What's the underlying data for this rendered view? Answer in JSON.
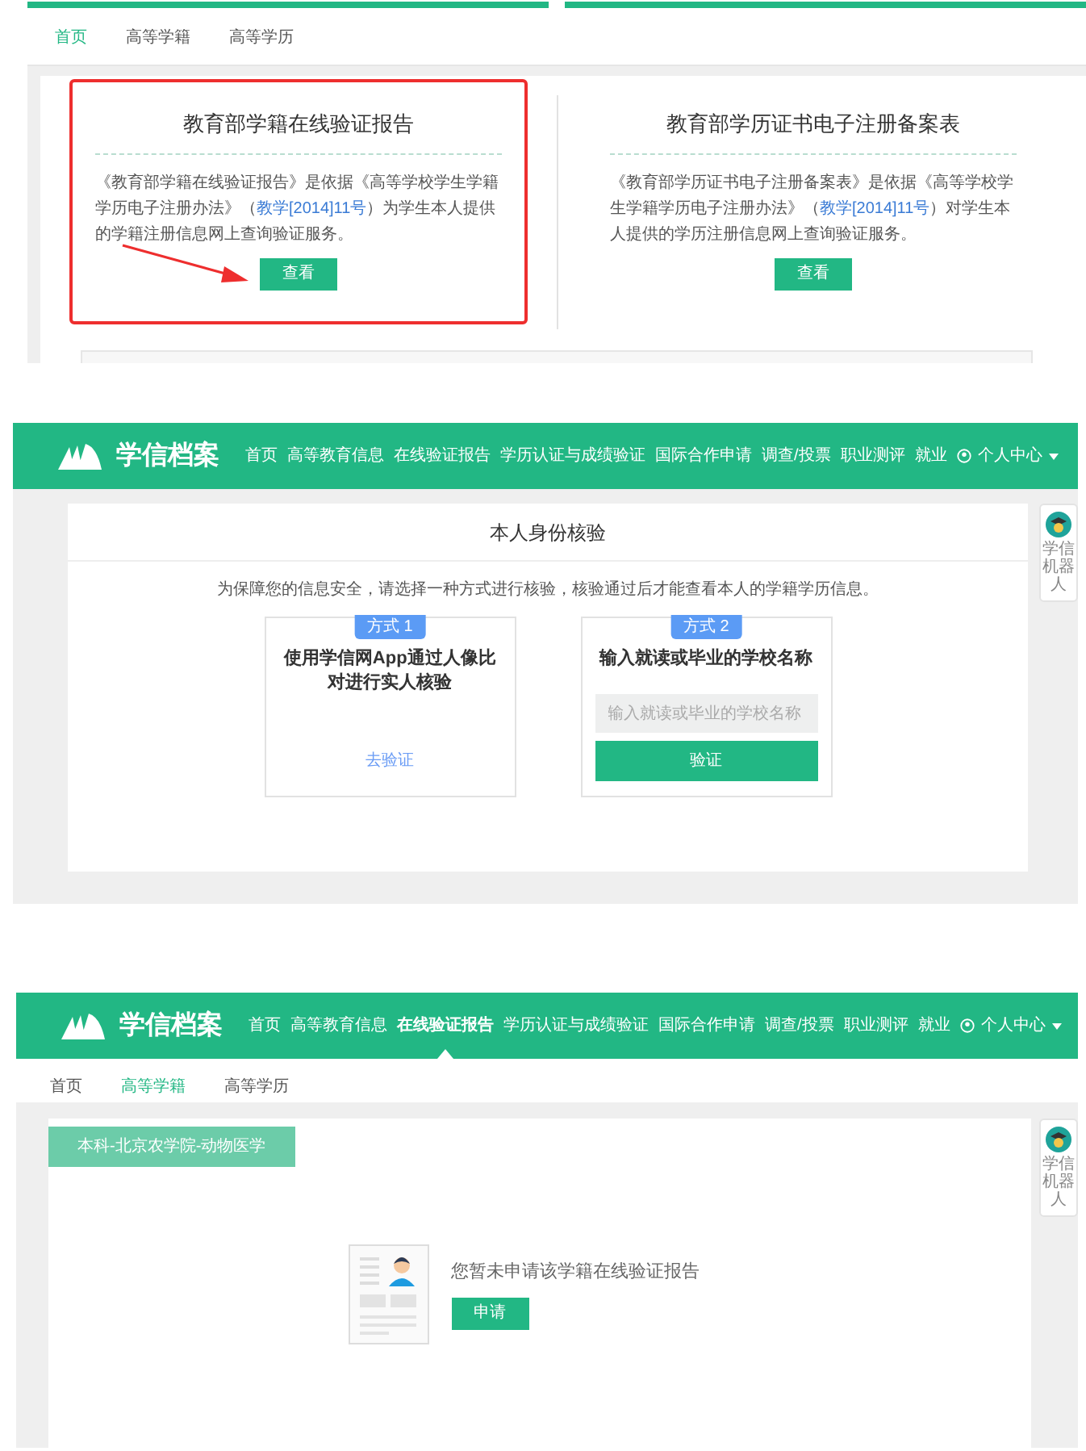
{
  "report_page": {
    "tabs": [
      {
        "label": "首页",
        "selected": true
      },
      {
        "label": "高等学籍",
        "selected": false
      },
      {
        "label": "高等学历",
        "selected": false
      }
    ],
    "cards": [
      {
        "title": "教育部学籍在线验证报告",
        "description": {
          "before": "《教育部学籍在线验证报告》是依据《高等学校学生学籍学历电子注册办法》（",
          "link": "教学[2014]11号",
          "after": "）为学生本人提供的学籍注册信息网上查询验证服务。"
        },
        "button": "查看",
        "highlighted": true,
        "pointer_arrow": true
      },
      {
        "title": "教育部学历证书电子注册备案表",
        "description": {
          "before": "《教育部学历证书电子注册备案表》是依据《高等学校学生学籍学历电子注册办法》（",
          "link": "教学[2014]11号",
          "after": "）对学生本人提供的学历注册信息网上查询验证服务。"
        },
        "button": "查看",
        "highlighted": false,
        "pointer_arrow": false
      }
    ]
  },
  "identity_page": {
    "navbar": {
      "logo": "学信档案",
      "items": [
        {
          "label": "首页",
          "selected": false
        },
        {
          "label": "高等教育信息",
          "selected": false
        },
        {
          "label": "在线验证报告",
          "selected": false
        },
        {
          "label": "学历认证与成绩验证",
          "selected": false
        },
        {
          "label": "国际合作申请",
          "selected": false
        },
        {
          "label": "调查/投票",
          "selected": false
        },
        {
          "label": "职业测评",
          "selected": false
        },
        {
          "label": "就业",
          "selected": false
        }
      ],
      "user_menu": "个人中心"
    },
    "title": "本人身份核验",
    "notice": "为保障您的信息安全，请选择一种方式进行核验，核验通过后才能查看本人的学籍学历信息。",
    "methods": [
      {
        "badge": "方式 1",
        "title": "使用学信网App通过人像比对进行实人核验",
        "kind": "link",
        "action": "去验证"
      },
      {
        "badge": "方式 2",
        "title": "输入就读或毕业的学校名称",
        "kind": "form",
        "placeholder": "输入就读或毕业的学校名称",
        "action": "验证"
      }
    ],
    "robot_widget": {
      "label": "学信机器人"
    }
  },
  "record_page": {
    "navbar": {
      "logo": "学信档案",
      "items": [
        {
          "label": "首页",
          "selected": false
        },
        {
          "label": "高等教育信息",
          "selected": false
        },
        {
          "label": "在线验证报告",
          "selected": true
        },
        {
          "label": "学历认证与成绩验证",
          "selected": false
        },
        {
          "label": "国际合作申请",
          "selected": false
        },
        {
          "label": "调查/投票",
          "selected": false
        },
        {
          "label": "职业测评",
          "selected": false
        },
        {
          "label": "就业",
          "selected": false
        }
      ],
      "user_menu": "个人中心"
    },
    "tabs": [
      {
        "label": "首页",
        "selected": false
      },
      {
        "label": "高等学籍",
        "selected": true
      },
      {
        "label": "高等学历",
        "selected": false
      }
    ],
    "record_tag": "本科-北京农学院-动物医学",
    "empty_message": "您暂未申请该学籍在线验证报告",
    "button": "申请",
    "robot_widget": {
      "label": "学信机器人"
    }
  }
}
